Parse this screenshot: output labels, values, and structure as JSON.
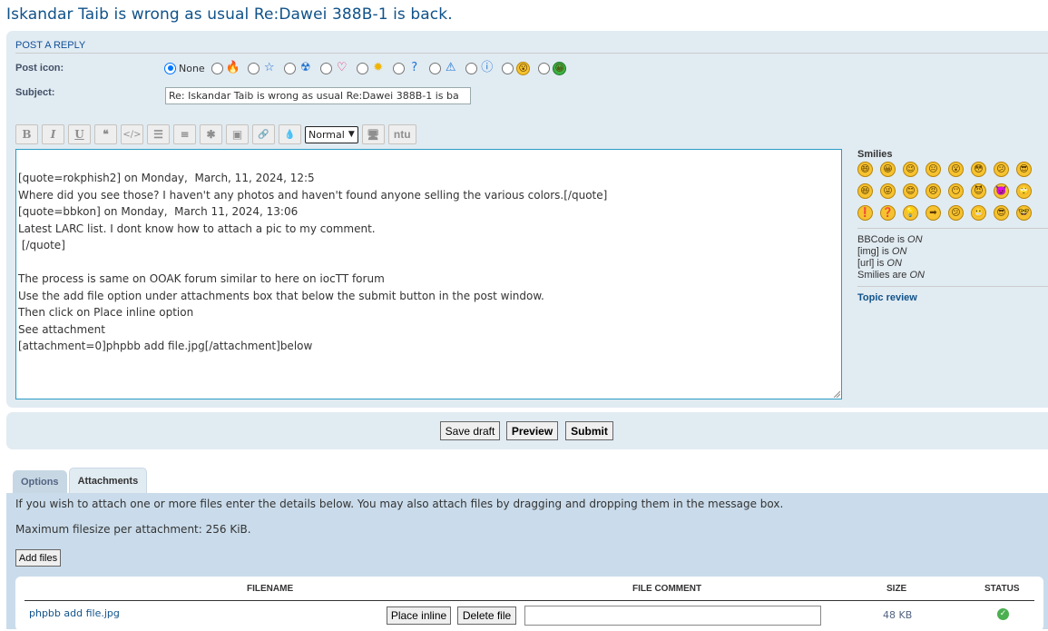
{
  "topic_title": "Iskandar Taib is wrong as usual Re:Dawei 388B-1 is back.",
  "post_panel": {
    "heading": "POST A REPLY",
    "post_icon_label": "Post icon:",
    "none_label": "None",
    "post_icons": [
      "fire-icon",
      "star-icon",
      "radioactive-icon",
      "heart-icon",
      "sun-icon",
      "question-icon",
      "warning-icon",
      "info-icon",
      "shocked-smiley-icon",
      "green-smiley-icon"
    ],
    "subject_label": "Subject:",
    "subject_value": "Re: Iskandar Taib is wrong as usual  Re:Dawei 388B-1 is ba"
  },
  "toolbar": {
    "bold": "B",
    "italic": "I",
    "underline": "U",
    "quote": "❝",
    "code": "</>",
    "list": "☰",
    "olist": "≡",
    "list_item": "✱",
    "image": "▣",
    "url": "🔗",
    "color": "💧",
    "font_size": "Normal",
    "screen": "🖥",
    "ntu": "ntu"
  },
  "editor_lines": [
    "[quote=rokphish2] on Monday,  March, 11, 2024, 12:5",
    "Where did you see those? I haven't any photos and haven't found anyone selling the various colors.[/quote]",
    "[quote=bbkon] on Monday,  March 11, 2024, 13:06",
    "Latest LARC list. I dont know how to attach a pic to my comment.",
    " [/quote]",
    "",
    "The process is same on OOAK forum similar to here on iocTT forum",
    "Use the add file option under attachments box that below the submit button in the post window.",
    "Then click on Place inline option",
    "See attachment",
    "[attachment=0]phpbb add file.jpg[/attachment]below"
  ],
  "smilies": {
    "title": "Smilies",
    "faces": [
      "😄",
      "😀",
      "😉",
      "😐",
      "😮",
      "😳",
      "😕",
      "😎",
      "😆",
      "😜",
      "😊",
      "😠",
      "😶",
      "😈",
      "👿",
      "🙄",
      "❗",
      "❓",
      "💡",
      "➡",
      "😕",
      "😬",
      "😎",
      "🤓"
    ],
    "bbcode": {
      "prefix": "BBCode is ",
      "state": "ON"
    },
    "img": {
      "prefix": "[img] is ",
      "state": "ON"
    },
    "url": {
      "prefix": "[url] is ",
      "state": "ON"
    },
    "smilies_state": {
      "prefix": "Smilies are ",
      "state": "ON"
    },
    "topic_review": "Topic review"
  },
  "submit_bar": {
    "save_draft": "Save draft",
    "preview": "Preview",
    "submit": "Submit"
  },
  "tabs": {
    "options": "Options",
    "attachments": "Attachments"
  },
  "attachments": {
    "intro": "If you wish to attach one or more files enter the details below. You may also attach files by dragging and dropping them in the message box.",
    "max_size": "Maximum filesize per attachment: 256 KiB.",
    "add_files": "Add files",
    "headers": {
      "filename": "FILENAME",
      "comment": "FILE COMMENT",
      "size": "SIZE",
      "status": "STATUS"
    },
    "files": [
      {
        "name": "phpbb add file.jpg",
        "place_inline": "Place inline",
        "delete": "Delete file",
        "size": "48 KB",
        "status": "✓"
      }
    ]
  }
}
